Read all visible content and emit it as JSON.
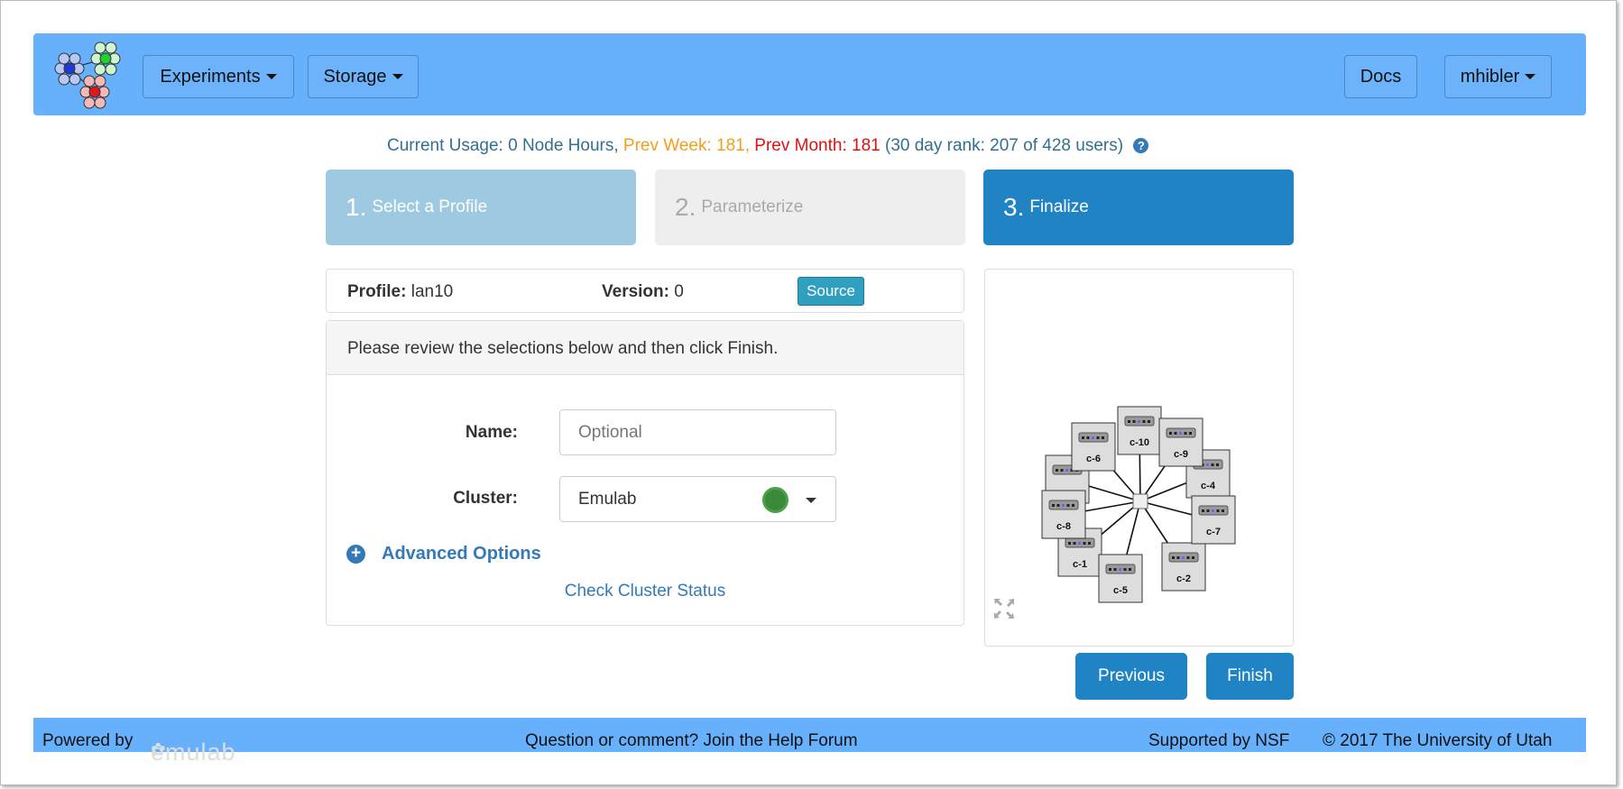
{
  "navbar": {
    "experiments": "Experiments",
    "storage": "Storage",
    "docs": "Docs",
    "user": "mhibler"
  },
  "usage": {
    "current": "Current Usage: 0 Node Hours,",
    "prev_week": "Prev Week: 181,",
    "prev_month": "Prev Month: 181",
    "rank": "(30 day rank: 207 of 428 users)"
  },
  "steps": [
    {
      "num": "1.",
      "label": "Select a Profile"
    },
    {
      "num": "2.",
      "label": "Parameterize"
    },
    {
      "num": "3.",
      "label": "Finalize"
    }
  ],
  "profile": {
    "profile_label": "Profile:",
    "profile_value": "lan10",
    "version_label": "Version:",
    "version_value": "0",
    "source": "Source"
  },
  "panel": {
    "heading": "Please review the selections below and then click Finish.",
    "name_label": "Name:",
    "name_placeholder": "Optional",
    "name_value": "",
    "cluster_label": "Cluster:",
    "cluster_value": "Emulab",
    "cluster_status_color": "#3a8a3a",
    "advanced": "Advanced Options",
    "check_status": "Check Cluster Status"
  },
  "topology": {
    "switch": "lan",
    "nodes": [
      {
        "label": ""
      },
      {
        "label": "c-1"
      },
      {
        "label": "c-4"
      },
      {
        "label": "c-2"
      },
      {
        "label": "c-5"
      },
      {
        "label": "c-10"
      },
      {
        "label": "c-6"
      },
      {
        "label": "c-9"
      },
      {
        "label": "c-8"
      },
      {
        "label": "c-7"
      }
    ]
  },
  "buttons": {
    "previous": "Previous",
    "finish": "Finish"
  },
  "footer": {
    "powered_by": "Powered by",
    "brand": "emulab",
    "help": "Question or comment? Join the Help Forum",
    "nsf": "Supported by NSF",
    "copyright": "© 2017 The University of Utah"
  },
  "colors": {
    "nav": "#66b0fc",
    "step_done": "#9ecae1",
    "step_pending": "#eeeeee",
    "step_active": "#2083c4",
    "prev_week": "#f0a020",
    "prev_month": "#e01010"
  }
}
